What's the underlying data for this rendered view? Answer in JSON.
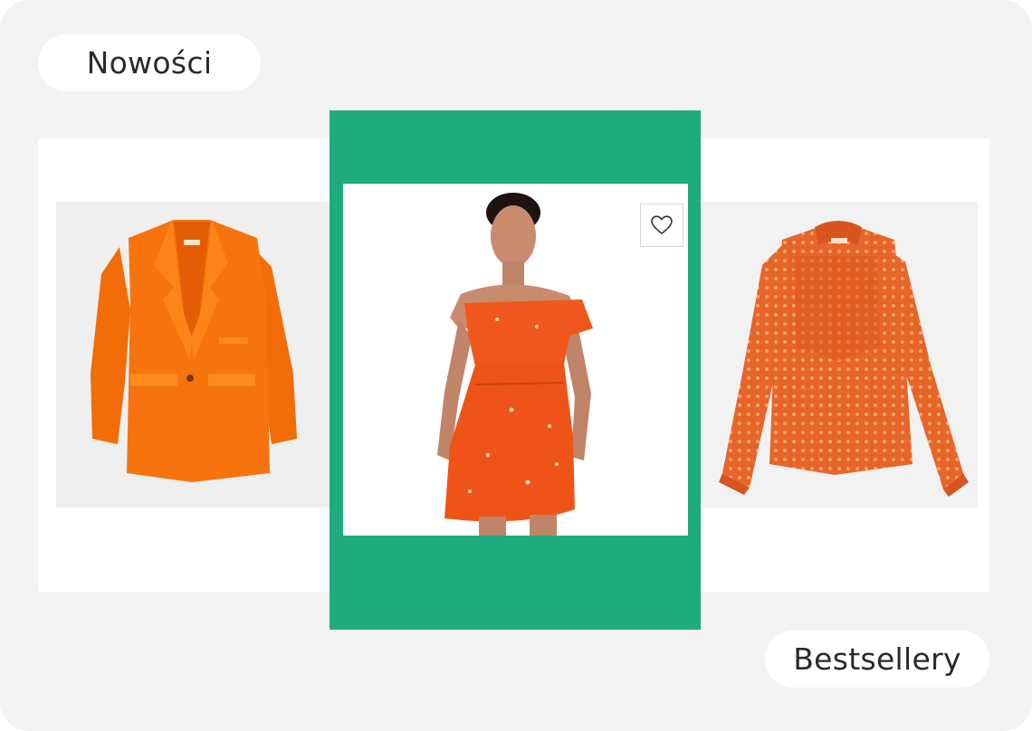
{
  "labels": {
    "new_arrivals": "Nowości",
    "bestsellers": "Bestsellery"
  },
  "products": [
    {
      "name": "blazer",
      "color": "#f7730e"
    },
    {
      "name": "dress",
      "color": "#f0571c"
    },
    {
      "name": "blouse",
      "color": "#e8652a"
    }
  ],
  "icons": {
    "favorite": "heart-icon"
  },
  "colors": {
    "background": "#f3f3f3",
    "highlight": "#1fac7c",
    "pill": "#ffffff"
  }
}
